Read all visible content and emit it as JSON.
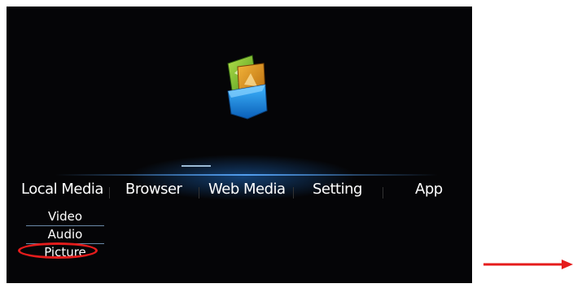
{
  "nav": {
    "items": [
      {
        "label": "Local Media"
      },
      {
        "label": "Browser"
      },
      {
        "label": "Web Media"
      },
      {
        "label": "Setting"
      },
      {
        "label": "App"
      }
    ]
  },
  "submenu": {
    "items": [
      {
        "label": "Video"
      },
      {
        "label": "Audio"
      },
      {
        "label": "Picture"
      }
    ]
  },
  "icon": {
    "name": "picture-folder-icon"
  },
  "colors": {
    "screen_background": "#050507",
    "accent_blue": "#1f8fe0",
    "annotation_red": "#e51c1c",
    "text": "#ffffff"
  }
}
